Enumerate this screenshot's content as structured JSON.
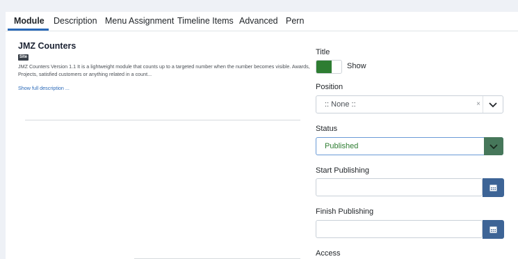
{
  "tabs": [
    {
      "label": "Module",
      "active": true
    },
    {
      "label": "Description",
      "active": false
    },
    {
      "label": "Menu Assignment",
      "active": false
    },
    {
      "label": "Timeline Items",
      "active": false
    },
    {
      "label": "Advanced",
      "active": false
    },
    {
      "label": "Pern",
      "active": false
    }
  ],
  "module": {
    "title": "JMZ Counters",
    "badge": "Site",
    "description": "JMZ Counters Version 1.1 It is a lightweight module that counts up to a targeted number when the number becomes visible. Awards, Projects, satisfied customers or anything related in a count...",
    "show_full": "Show full description ..."
  },
  "title_field": {
    "label": "Title",
    "toggle_label": "Show",
    "checked": true
  },
  "position": {
    "label": "Position",
    "value": ":: None ::",
    "clear": "×"
  },
  "status": {
    "label": "Status",
    "value": "Published"
  },
  "start_publishing": {
    "label": "Start Publishing",
    "value": ""
  },
  "finish_publishing": {
    "label": "Finish Publishing",
    "value": ""
  },
  "access": {
    "label": "Access"
  },
  "colors": {
    "accent": "#2a69b8",
    "toggle_on": "#2e7d32",
    "status_button": "#46775a",
    "calendar_button": "#3d6496"
  }
}
